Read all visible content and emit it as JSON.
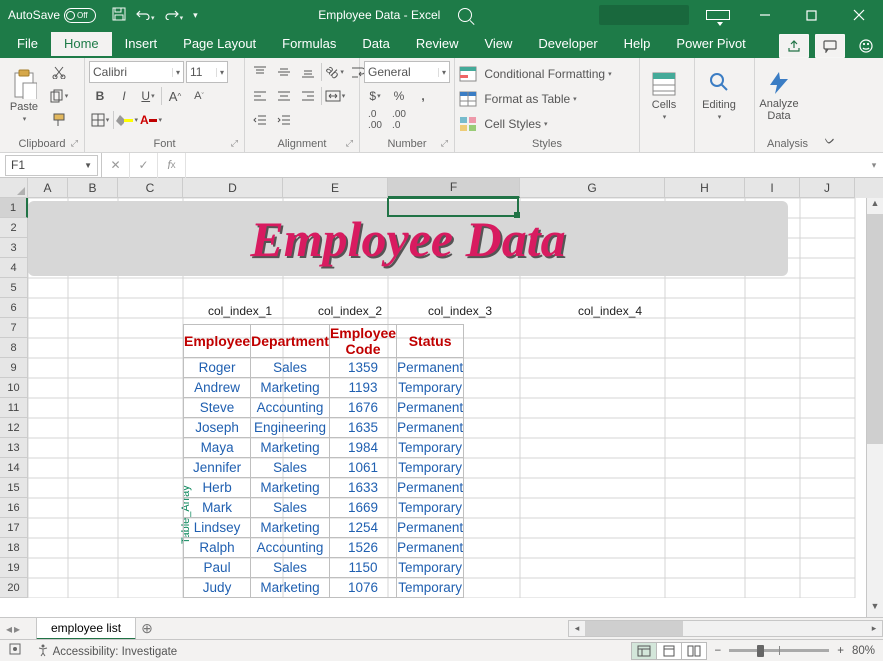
{
  "titlebar": {
    "autosave_label": "AutoSave",
    "autosave_state": "Off",
    "doc_title": "Employee Data  -  Excel"
  },
  "tabs": [
    "File",
    "Home",
    "Insert",
    "Page Layout",
    "Formulas",
    "Data",
    "Review",
    "View",
    "Developer",
    "Help",
    "Power Pivot"
  ],
  "active_tab": "Home",
  "ribbon": {
    "clipboard": {
      "label": "Clipboard",
      "paste": "Paste"
    },
    "font": {
      "label": "Font",
      "name": "Calibri",
      "size": "11"
    },
    "alignment": {
      "label": "Alignment"
    },
    "number": {
      "label": "Number",
      "format": "General"
    },
    "styles": {
      "label": "Styles",
      "cond": "Conditional Formatting",
      "table": "Format as Table",
      "cells": "Cell Styles"
    },
    "cells": {
      "label": "Cells",
      "btn": "Cells"
    },
    "editing": {
      "label": "Editing",
      "btn": "Editing"
    },
    "analysis": {
      "label": "Analysis",
      "btn": "Analyze Data"
    }
  },
  "namebox": "F1",
  "columns": [
    {
      "l": "A",
      "w": 40
    },
    {
      "l": "B",
      "w": 50
    },
    {
      "l": "C",
      "w": 65
    },
    {
      "l": "D",
      "w": 100
    },
    {
      "l": "E",
      "w": 105
    },
    {
      "l": "F",
      "w": 132
    },
    {
      "l": "G",
      "w": 145
    },
    {
      "l": "H",
      "w": 80
    },
    {
      "l": "I",
      "w": 55
    },
    {
      "l": "J",
      "w": 55
    }
  ],
  "row_count": 20,
  "banner_text": "Employee Data",
  "col_index_labels": [
    "col_index_1",
    "col_index_2",
    "col_index_3",
    "col_index_4"
  ],
  "table_array_label": "Table_Array",
  "table": {
    "headers": [
      "Employee",
      "Department",
      "Employee Code",
      "Status"
    ],
    "rows": [
      [
        "Roger",
        "Sales",
        "1359",
        "Permanent"
      ],
      [
        "Andrew",
        "Marketing",
        "1193",
        "Temporary"
      ],
      [
        "Steve",
        "Accounting",
        "1676",
        "Permanent"
      ],
      [
        "Joseph",
        "Engineering",
        "1635",
        "Permanent"
      ],
      [
        "Maya",
        "Marketing",
        "1984",
        "Temporary"
      ],
      [
        "Jennifer",
        "Sales",
        "1061",
        "Temporary"
      ],
      [
        "Herb",
        "Marketing",
        "1633",
        "Permanent"
      ],
      [
        "Mark",
        "Sales",
        "1669",
        "Temporary"
      ],
      [
        "Lindsey",
        "Marketing",
        "1254",
        "Permanent"
      ],
      [
        "Ralph",
        "Accounting",
        "1526",
        "Permanent"
      ],
      [
        "Paul",
        "Sales",
        "1150",
        "Temporary"
      ],
      [
        "Judy",
        "Marketing",
        "1076",
        "Temporary"
      ]
    ]
  },
  "sheet_tab": "employee list",
  "status": {
    "accessibility": "Accessibility: Investigate",
    "zoom": "80%"
  }
}
